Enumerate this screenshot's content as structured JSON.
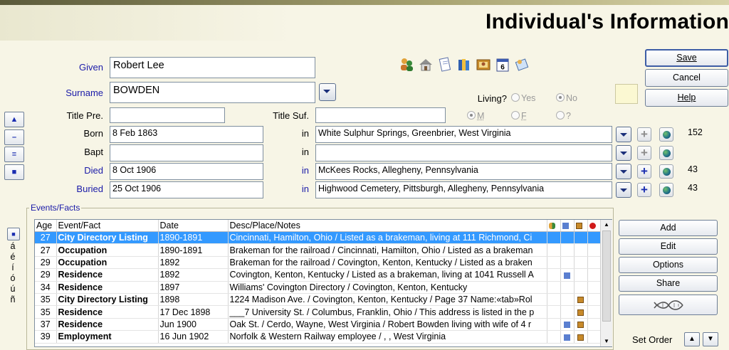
{
  "header": {
    "title": "Individual's Information"
  },
  "name": {
    "given_label": "Given",
    "given_value": "Robert Lee",
    "surname_label": "Surname",
    "surname_value": "BOWDEN",
    "title_pre_label": "Title Pre.",
    "title_pre_value": "",
    "title_suf_label": "Title Suf.",
    "title_suf_value": ""
  },
  "living": {
    "label": "Living?",
    "yes": "Yes",
    "no": "No",
    "selected": "No"
  },
  "sex": {
    "male": "M",
    "female": "F",
    "unknown": "?",
    "selected": "M"
  },
  "vitals": [
    {
      "label": "Born",
      "date": "8 Feb 1863",
      "in_label": "in",
      "place": "White Sulphur Springs, Greenbrier, West Virginia",
      "count": "152",
      "label_color": "#000000"
    },
    {
      "label": "Bapt",
      "date": "",
      "in_label": "in",
      "place": "",
      "count": "",
      "label_color": "#000000"
    },
    {
      "label": "Died",
      "date": "8 Oct 1906",
      "in_label": "in",
      "place": "McKees Rocks, Allegheny, Pennsylvania",
      "count": "43",
      "label_color": "#1a1aa8"
    },
    {
      "label": "Buried",
      "date": "25 Oct 1906",
      "in_label": "in",
      "place": "Highwood Cemetery, Pittsburgh, Allegheny, Pennsylvania",
      "count": "43",
      "label_color": "#1a1aa8"
    }
  ],
  "buttons": {
    "save": "Save",
    "cancel": "Cancel",
    "help": "Help"
  },
  "toolbar_icons": [
    "family-icon",
    "house-icon",
    "notes-icon",
    "books-icon",
    "picture-icon",
    "calendar-icon",
    "address-book-icon"
  ],
  "toolbar_calendar_digit": "6",
  "side_buttons": [
    "▲",
    "–",
    "≡",
    "■"
  ],
  "accent_chars": [
    "á",
    "é",
    "í",
    "ó",
    "ú",
    "ñ"
  ],
  "events": {
    "legend": "Events/Facts",
    "columns": [
      "Age",
      "Event/Fact",
      "Date",
      "Desc/Place/Notes"
    ],
    "rows": [
      {
        "age": "27",
        "event": "City Directory Listing",
        "date": "1890-1891",
        "desc": "Cincinnati, Hamilton, Ohio / Listed as a brakeman, living at 111 Richmond, Ci",
        "selected": true,
        "src": false,
        "media": false
      },
      {
        "age": "27",
        "event": "Occupation",
        "date": "1890-1891",
        "desc": "Brakeman for the railroad / Cincinnati, Hamilton, Ohio / Listed as a brakeman",
        "selected": false,
        "src": false,
        "media": false
      },
      {
        "age": "29",
        "event": "Occupation",
        "date": "1892",
        "desc": "Brakeman for the railroad / Covington, Kenton, Kentucky / Listed as a braken",
        "selected": false,
        "src": false,
        "media": false
      },
      {
        "age": "29",
        "event": "Residence",
        "date": "1892",
        "desc": "Covington, Kenton, Kentucky / Listed as a brakeman, living at 1041 Russell A",
        "selected": false,
        "src": true,
        "media": false
      },
      {
        "age": "34",
        "event": "Residence",
        "date": "1897",
        "desc": "Williams' Covington Directory / Covington, Kenton, Kentucky",
        "selected": false,
        "src": false,
        "media": false
      },
      {
        "age": "35",
        "event": "City Directory Listing",
        "date": "1898",
        "desc": "1224 Madison Ave. / Covington, Kenton, Kentucky / Page 37 Name:«tab»Rol",
        "selected": false,
        "src": false,
        "media": true
      },
      {
        "age": "35",
        "event": "Residence",
        "date": "17 Dec 1898",
        "desc": "___7 University St. / Columbus, Franklin, Ohio / This address is listed in the p",
        "selected": false,
        "src": false,
        "media": true
      },
      {
        "age": "37",
        "event": "Residence",
        "date": "Jun 1900",
        "desc": "Oak St. / Cerdo, Wayne, West Virginia / Robert Bowden living with wife of 4 r",
        "selected": false,
        "src": true,
        "media": true
      },
      {
        "age": "39",
        "event": "Employment",
        "date": "16 Jun 1902",
        "desc": "Norfolk & Western Railway employee / , , West Virginia",
        "selected": false,
        "src": true,
        "media": true
      }
    ]
  },
  "event_buttons": {
    "add": "Add",
    "edit": "Edit",
    "options": "Options",
    "share": "Share",
    "dna": "DNA"
  },
  "set_order": {
    "label": "Set Order"
  },
  "colors": {
    "label_blue": "#1a1aa8",
    "selection": "#3399ff",
    "background": "#f7f5e6"
  }
}
